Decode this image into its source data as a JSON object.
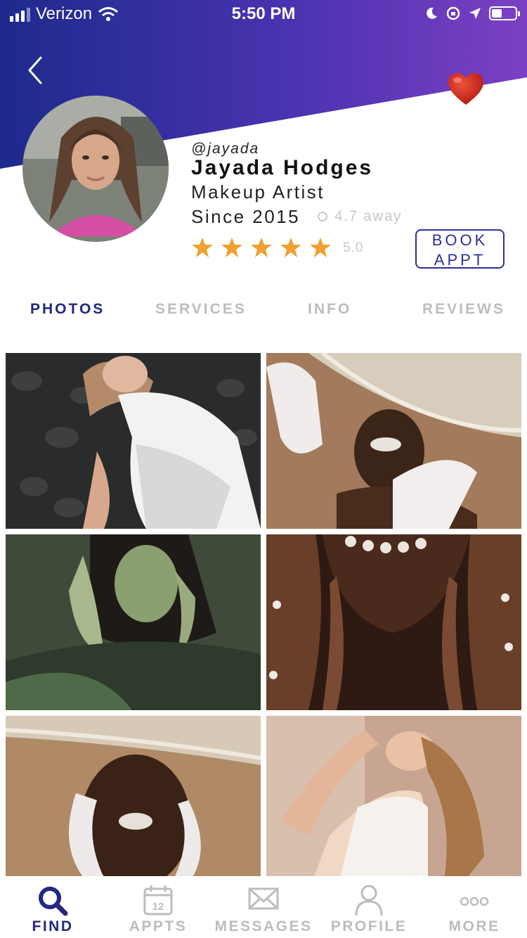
{
  "status_bar": {
    "carrier": "Verizon",
    "time": "5:50 PM"
  },
  "profile": {
    "handle": "@jayada",
    "name": "Jayada Hodges",
    "role": "Makeup Artist",
    "since": "Since 2015",
    "distance": "4.7 away",
    "stars": 5,
    "rating": "5.0",
    "book_label_line1": "BOOK",
    "book_label_line2": "APPT"
  },
  "tabs": [
    {
      "label": "PHOTOS",
      "active": true
    },
    {
      "label": "SERVICES",
      "active": false
    },
    {
      "label": "INFO",
      "active": false
    },
    {
      "label": "REVIEWS",
      "active": false
    }
  ],
  "photos": [
    {
      "name": "photo-woman-white-dress"
    },
    {
      "name": "photo-pearl-hat-lace-glove"
    },
    {
      "name": "photo-green-light-portrait"
    },
    {
      "name": "photo-pearl-necklace-hands"
    },
    {
      "name": "photo-pearl-hat-pearl-lips"
    },
    {
      "name": "photo-woman-arms-raised"
    }
  ],
  "bottom_nav": [
    {
      "label": "FIND",
      "icon": "search-icon",
      "active": true
    },
    {
      "label": "APPTS",
      "icon": "calendar-icon",
      "calendar_day": "12",
      "active": false
    },
    {
      "label": "MESSAGES",
      "icon": "envelope-icon",
      "active": false
    },
    {
      "label": "PROFILE",
      "icon": "person-icon",
      "active": false
    },
    {
      "label": "MORE",
      "icon": "more-icon",
      "active": false
    }
  ],
  "colors": {
    "header_gradient_start": "#1f2a8e",
    "header_gradient_end": "#7a3fc2",
    "accent_navy": "#25287f",
    "star_orange": "#f0a030",
    "heart_red": "#d42a22",
    "inactive_gray": "#bdbdbd"
  }
}
